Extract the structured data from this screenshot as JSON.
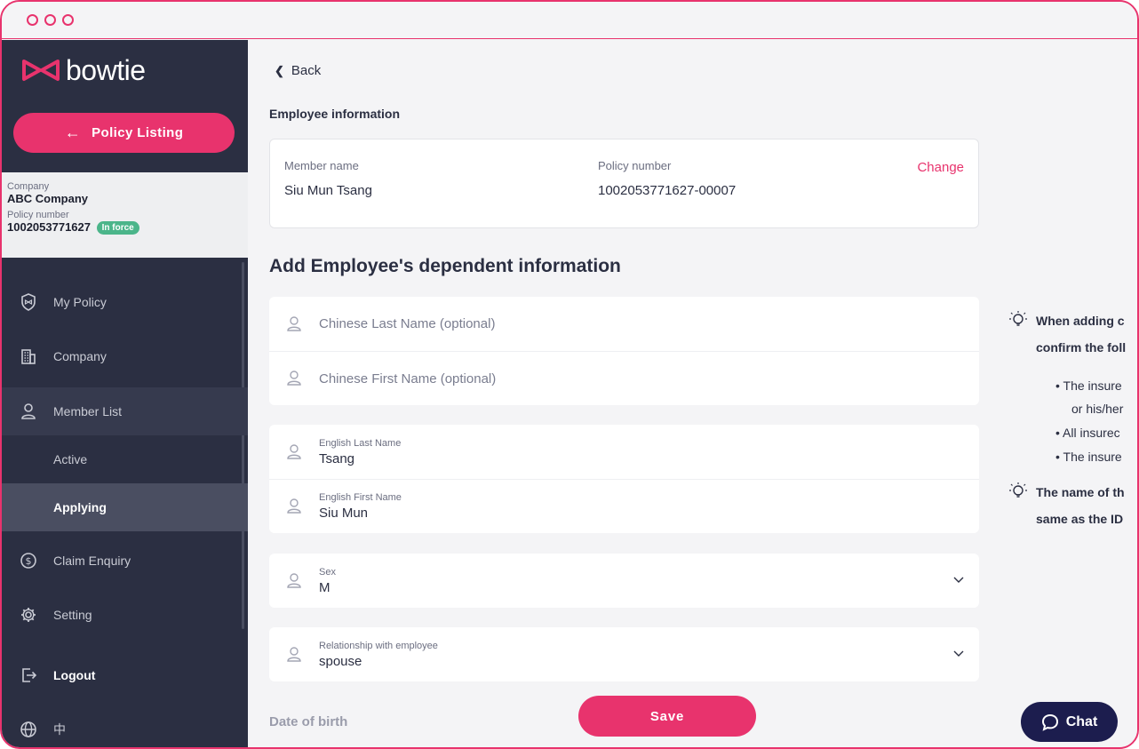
{
  "brand": {
    "name": "bowtie",
    "accent": "#e8336d",
    "sidebar_bg": "#2b2f42",
    "chat_bg": "#1c1d4e"
  },
  "sidebar": {
    "policy_listing_label": "Policy Listing",
    "company_label": "Company",
    "company_value": "ABC Company",
    "policy_label": "Policy number",
    "policy_value": "1002053771627",
    "status_badge": "In force",
    "nav": [
      {
        "label": "My Policy",
        "icon": "shield-bowtie-icon"
      },
      {
        "label": "Company",
        "icon": "building-icon"
      },
      {
        "label": "Member List",
        "icon": "person-icon"
      },
      {
        "label": "Claim Enquiry",
        "icon": "dollar-circle-icon"
      },
      {
        "label": "Setting",
        "icon": "gear-icon"
      },
      {
        "label": "Logout",
        "icon": "logout-icon"
      },
      {
        "label": "中",
        "icon": "globe-icon"
      }
    ],
    "sub_nav": [
      {
        "label": "Active"
      },
      {
        "label": "Applying"
      }
    ]
  },
  "main": {
    "back_label": "Back",
    "employee_section_title": "Employee information",
    "employee": {
      "member_name_label": "Member name",
      "member_name": "Siu Mun Tsang",
      "policy_number_label": "Policy number",
      "policy_number": "1002053771627-00007",
      "change_label": "Change"
    },
    "dependent_title": "Add Employee's dependent information",
    "fields": {
      "chinese_last_placeholder": "Chinese Last Name (optional)",
      "chinese_first_placeholder": "Chinese First Name (optional)",
      "english_last_label": "English Last Name",
      "english_last_value": "Tsang",
      "english_first_label": "English First Name",
      "english_first_value": "Siu Mun",
      "sex_label": "Sex",
      "sex_value": "M",
      "relationship_label": "Relationship with employee",
      "relationship_value": "spouse"
    },
    "dob_label": "Date of birth",
    "save_label": "Save",
    "chat_label": "Chat",
    "tips": {
      "tip1_line1": "When adding c",
      "tip1_line2": "confirm the foll",
      "bullets": [
        "The insure",
        "or his/her",
        "All insurec",
        "The insure"
      ],
      "tip2_line1": "The name of th",
      "tip2_line2": "same as the ID"
    }
  }
}
